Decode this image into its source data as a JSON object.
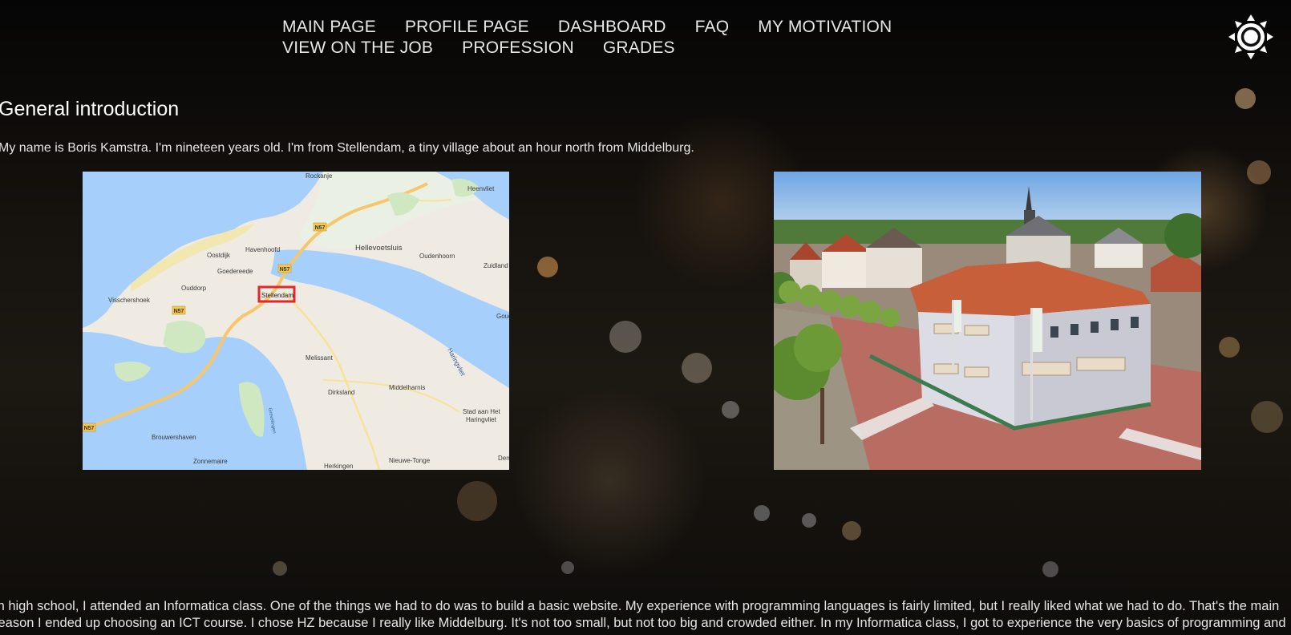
{
  "nav": {
    "items": [
      {
        "label": "MAIN PAGE"
      },
      {
        "label": "PROFILE PAGE"
      },
      {
        "label": "DASHBOARD"
      },
      {
        "label": "FAQ"
      },
      {
        "label": "MY MOTIVATION"
      },
      {
        "label": "VIEW ON THE JOB"
      },
      {
        "label": "PROFESSION"
      },
      {
        "label": "GRADES"
      }
    ]
  },
  "theme_toggle": {
    "icon": "sun-icon"
  },
  "section": {
    "heading": "General introduction",
    "intro": "My name is Boris Kamstra. I'm nineteen years old. I'm from Stellendam, a tiny village about an hour north from Middelburg.",
    "body_line1": "In high school, I attended an Informatica class. One of the things we had to do was to build a basic website. My experience with programming languages is fairly limited, but I really liked what we had to do. That's the main",
    "body_line2": "reason I ended up choosing an ICT course. I chose HZ because I really like Middelburg. It's not too small, but not too big and crowded either. In my Informatica class, I got to experience the very basics of programming and I"
  },
  "map": {
    "labels": {
      "rockanje": "Rockanje",
      "heenvliet": "Heenvliet",
      "hellevoetsluis": "Hellevoetsluis",
      "oudenhoorn": "Oudenhoorn",
      "zuidland": "Zuidland",
      "oostdijk": "Oostdijk",
      "havenhoofd": "Havenhoofd",
      "goedereede": "Goedereede",
      "ouddorp": "Ouddorp",
      "stellendam": "Stellendam",
      "visschershoek": "Visschershoek",
      "melissant": "Melissant",
      "dirksland": "Dirksland",
      "middelharnis": "Middelharnis",
      "haringvliet": "Haringvliet",
      "stad_aan_het": "Stad aan Het",
      "haringvliet_town": "Haringvliet",
      "brouwershaven": "Brouwershaven",
      "zonnemaire": "Zonnemaire",
      "herkingen": "Herkingen",
      "nieuwe_tonge": "Nieuwe-Tonge",
      "goud": "Goud",
      "den": "Den",
      "grevelingen": "Grevelingen",
      "road_n57_a": "N57",
      "road_n57_b": "N57",
      "road_n57_c": "N57",
      "road_n57_d": "N57"
    }
  },
  "colors": {
    "water": "#a6cffc",
    "land": "#efebe2",
    "road": "#f6c66b",
    "highlight": "#e3262b"
  }
}
